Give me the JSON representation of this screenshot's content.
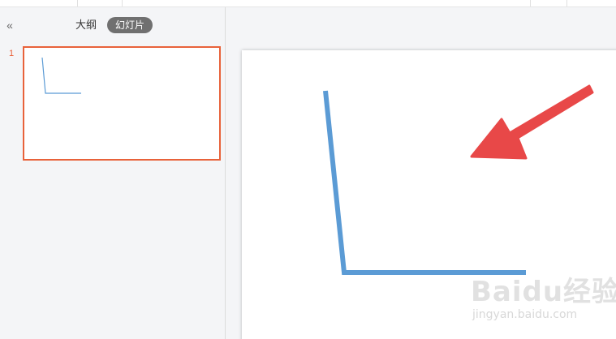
{
  "sidebar": {
    "collapse_icon": "double-chevron-left-icon",
    "collapse_glyph": "«",
    "tabs": [
      {
        "label": "大纲",
        "active": false
      },
      {
        "label": "幻灯片",
        "active": true
      }
    ],
    "slides": [
      {
        "number": "1",
        "selected": true
      }
    ]
  },
  "slide": {
    "shapes": [
      "blue-l-line",
      "red-arrow"
    ],
    "line_color": "#5b9bd5",
    "arrow_color": "#e84848"
  },
  "colors": {
    "accent": "#e8623a",
    "tab_active_bg": "#707070"
  },
  "watermark": {
    "logo": "Baidu经验",
    "url": "jingyan.baidu.com"
  }
}
